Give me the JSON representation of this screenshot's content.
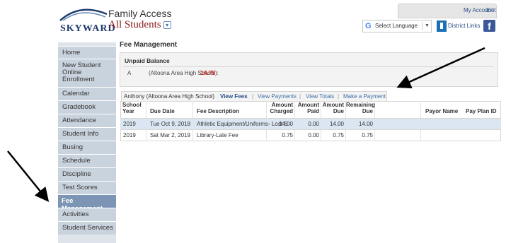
{
  "header": {
    "logo_text": "SKYWARD",
    "app_title": "Family Access",
    "student_selector": "All Students",
    "links": {
      "account": "My Account",
      "exit": "Exit"
    },
    "language": {
      "label": "Select Language"
    },
    "district_links": "District Links"
  },
  "sidebar": {
    "items": [
      {
        "label": "Home"
      },
      {
        "label": "New Student Online Enrollment"
      },
      {
        "label": "Calendar"
      },
      {
        "label": "Gradebook"
      },
      {
        "label": "Attendance"
      },
      {
        "label": "Student Info"
      },
      {
        "label": "Busing"
      },
      {
        "label": "Schedule"
      },
      {
        "label": "Discipline"
      },
      {
        "label": "Test Scores"
      },
      {
        "label": "Fee Management"
      },
      {
        "label": "Activities"
      },
      {
        "label": "Student Services"
      }
    ],
    "active": "Fee Management"
  },
  "main": {
    "title": "Fee Management",
    "unpaid": {
      "title": "Unpaid Balance",
      "student_initial": "A",
      "school": "(Altoona Area High School):",
      "amount": "14.75"
    },
    "subnav": {
      "current": "Anthony (Altoona Area High School)",
      "items": [
        "View Fees",
        "View Payments",
        "View Totals",
        "Make a Payment"
      ],
      "active": "View Fees"
    },
    "table": {
      "headers": [
        "School Year",
        "Due Date",
        "Fee Description",
        "Amount Charged",
        "Amount Paid",
        "Amount Due",
        "Remaining Due",
        "Payor Name",
        "Pay Plan ID"
      ],
      "rows": [
        [
          "2019",
          "Tue Oct 9, 2018",
          "Athletic Equipment/Uniforms- Lost S",
          "14.00",
          "0.00",
          "14.00",
          "14.00",
          "",
          ""
        ],
        [
          "2019",
          "Sat Mar 2, 2019",
          "Library-Late Fee",
          "0.75",
          "0.00",
          "0.75",
          "0.75",
          "",
          ""
        ]
      ]
    }
  },
  "colors": {
    "sidebar_bg": "#c9d3dd",
    "sidebar_active": "#7d95b4",
    "row_highlight": "#dbe6f2",
    "balance_red": "#d21f1f",
    "brand_navy": "#1d3b6e"
  }
}
